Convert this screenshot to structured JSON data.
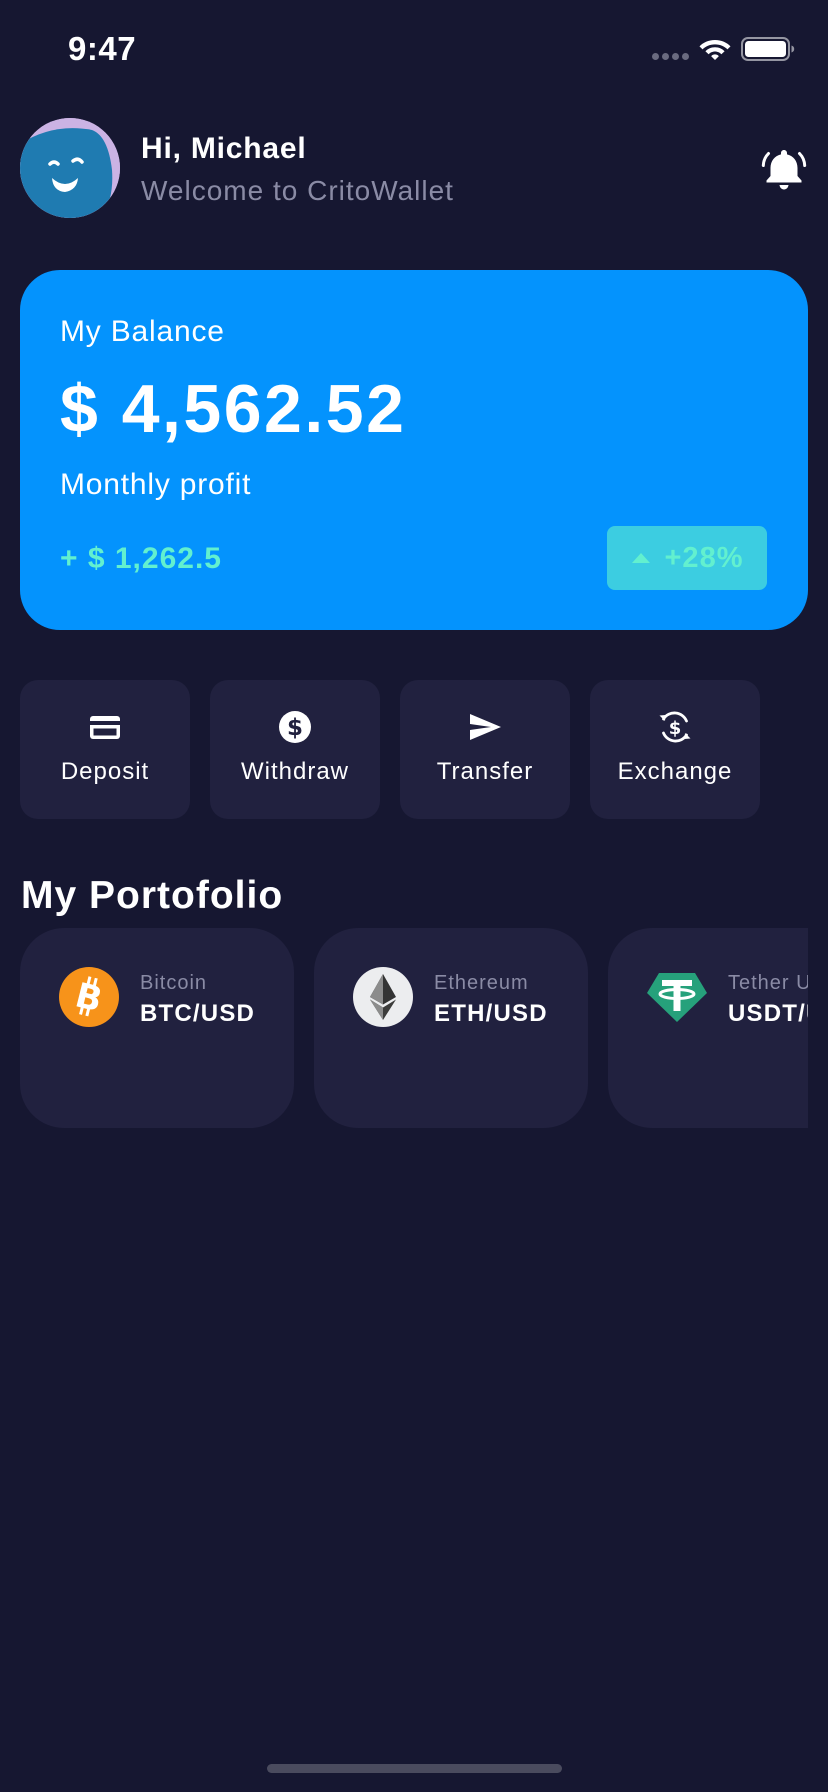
{
  "status_bar": {
    "time": "9:47"
  },
  "header": {
    "greeting": "Hi, Michael",
    "subtitle": "Welcome to CritoWallet"
  },
  "balance": {
    "label": "My Balance",
    "amount": "$ 4,562.52",
    "profit_label": "Monthly profit",
    "profit_amount": "+ $ 1,262.5",
    "profit_change": "+28%"
  },
  "actions": [
    {
      "label": "Deposit",
      "icon": "credit-card-icon"
    },
    {
      "label": "Withdraw",
      "icon": "dollar-coin-icon"
    },
    {
      "label": "Transfer",
      "icon": "send-icon"
    },
    {
      "label": "Exchange",
      "icon": "currency-exchange-icon"
    }
  ],
  "portfolio": {
    "title": "My Portofolio",
    "items": [
      {
        "name": "Bitcoin",
        "pair": "BTC/USD",
        "icon": "bitcoin-icon"
      },
      {
        "name": "Ethereum",
        "pair": "ETH/USD",
        "icon": "ethereum-icon"
      },
      {
        "name": "Tether USDT",
        "pair": "USDT/USD",
        "icon": "tether-icon"
      }
    ]
  },
  "colors": {
    "background": "#161731",
    "card": "#21213f",
    "balance_card": "#0493fd",
    "profit_text": "#62f0cf",
    "profit_badge": "#3ccde1",
    "muted_text": "#8a8ba5",
    "bitcoin": "#f7931a",
    "tether": "#26a17b"
  }
}
